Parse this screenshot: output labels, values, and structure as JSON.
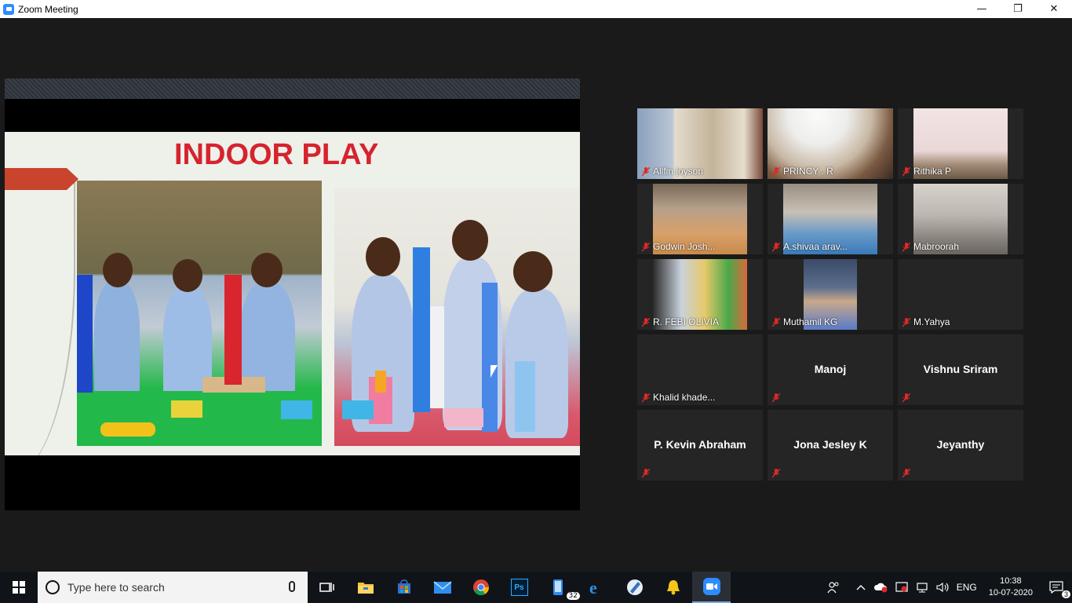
{
  "window": {
    "title": "Zoom Meeting",
    "minimize": "—",
    "restore": "❐",
    "close": "✕"
  },
  "slide": {
    "title": "INDOOR PLAY"
  },
  "participants": [
    {
      "name": "Allfin joyson",
      "video": true,
      "muted": true
    },
    {
      "name": "PRINCY . R",
      "video": true,
      "muted": true
    },
    {
      "name": "Rithika P",
      "video": true,
      "muted": true
    },
    {
      "name": "Godwin Josh...",
      "video": true,
      "muted": true
    },
    {
      "name": "A.shivaa arav...",
      "video": true,
      "muted": true
    },
    {
      "name": "Mabroorah",
      "video": true,
      "muted": true
    },
    {
      "name": "R. FEBI  OLIVIA",
      "video": true,
      "muted": true
    },
    {
      "name": "Muthamil KG",
      "video": true,
      "muted": true
    },
    {
      "name": "M.Yahya",
      "video": false,
      "muted": true
    },
    {
      "name": "Khalid khade...",
      "video": false,
      "muted": true
    },
    {
      "name": "Manoj",
      "video": false,
      "muted": true
    },
    {
      "name": "Vishnu Sriram",
      "video": false,
      "muted": true
    },
    {
      "name": "P. Kevin Abraham",
      "video": false,
      "muted": true
    },
    {
      "name": "Jona Jesley K",
      "video": false,
      "muted": true
    },
    {
      "name": "Jeyanthy",
      "video": false,
      "muted": true
    }
  ],
  "taskbar": {
    "search_placeholder": "Type here to search",
    "pinned": [
      "task-view-icon",
      "file-explorer-icon",
      "store-icon",
      "mail-icon",
      "chrome-icon",
      "photoshop-icon",
      "phone-icon",
      "edge-icon",
      "notepad-icon",
      "bell-icon",
      "zoom-icon"
    ],
    "photoshop_label": "Ps",
    "phone_badge": "32",
    "tray": {
      "language": "ENG",
      "time": "10:38",
      "date": "10-07-2020",
      "notifications": "3"
    }
  },
  "colors": {
    "accent": "#2d8cff",
    "mute_red": "#e02828",
    "slide_title": "#d6232e"
  }
}
